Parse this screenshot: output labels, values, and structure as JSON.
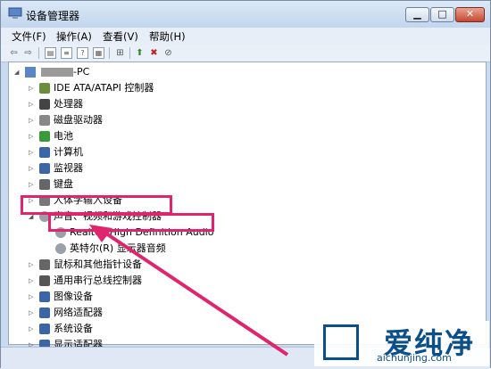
{
  "window": {
    "title": "设备管理器"
  },
  "menu": [
    {
      "label": "文件(F)"
    },
    {
      "label": "操作(A)"
    },
    {
      "label": "查看(V)"
    },
    {
      "label": "帮助(H)"
    }
  ],
  "tree": {
    "root": {
      "label": "-PC"
    },
    "items": [
      {
        "label": "IDE ATA/ATAPI 控制器",
        "icon": "ide-controller-icon"
      },
      {
        "label": "处理器",
        "icon": "processor-icon"
      },
      {
        "label": "磁盘驱动器",
        "icon": "disk-drive-icon"
      },
      {
        "label": "电池",
        "icon": "battery-icon"
      },
      {
        "label": "计算机",
        "icon": "computer-icon"
      },
      {
        "label": "监视器",
        "icon": "monitor-icon"
      },
      {
        "label": "键盘",
        "icon": "keyboard-icon"
      },
      {
        "label": "人体学输入设备",
        "icon": "hid-icon"
      },
      {
        "label": "声音、视频和游戏控制器",
        "icon": "sound-icon",
        "expanded": true,
        "children": [
          {
            "label": "Realtek High Definition Audio",
            "icon": "audio-device-icon"
          },
          {
            "label": "英特尔(R) 显示器音频",
            "icon": "audio-device-icon"
          }
        ]
      },
      {
        "label": "鼠标和其他指针设备",
        "icon": "mouse-icon"
      },
      {
        "label": "通用串行总线控制器",
        "icon": "usb-icon"
      },
      {
        "label": "图像设备",
        "icon": "camera-icon"
      },
      {
        "label": "网络适配器",
        "icon": "network-icon"
      },
      {
        "label": "系统设备",
        "icon": "system-device-icon"
      },
      {
        "label": "显示适配器",
        "icon": "display-adapter-icon"
      }
    ]
  },
  "watermark": {
    "title": "爱纯净",
    "url": "aichunjing.com"
  },
  "colors": {
    "highlight": "#e0246e",
    "brand": "#0b4f8a"
  }
}
